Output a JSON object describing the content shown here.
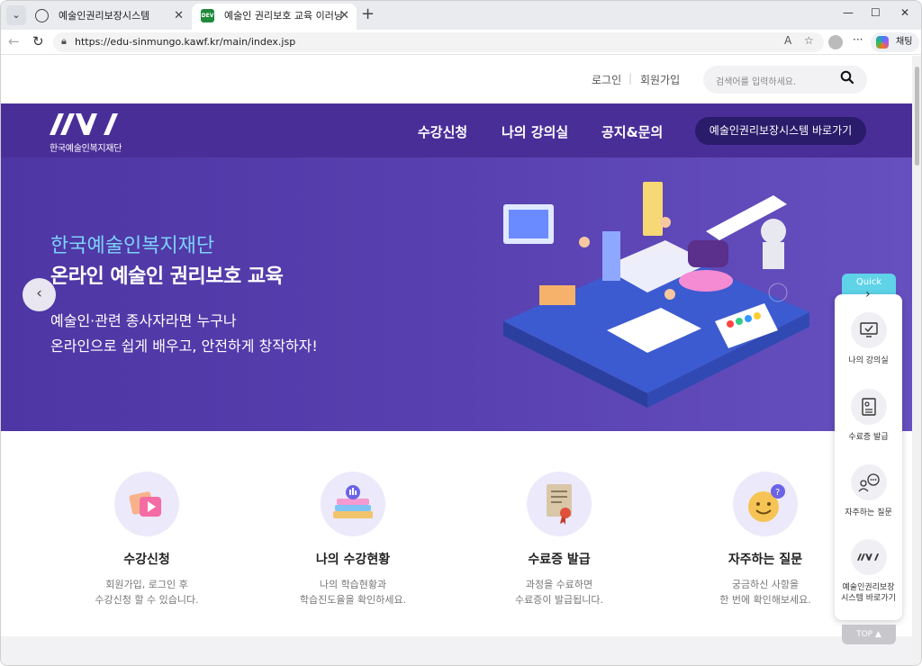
{
  "browser": {
    "tabs": [
      {
        "title": "예술인권리보장시스템"
      },
      {
        "title": "예술인 권리보호 교육 이러닝"
      }
    ],
    "address": "https://edu-sinmungo.kawf.kr/main/index.jsp",
    "copilot_label": "채팅",
    "dev_badge": "DEV"
  },
  "util": {
    "login": "로그인",
    "join": "회원가입",
    "search_placeholder": "검색어를 입력하세요."
  },
  "header": {
    "logo_mark": "KAWF",
    "logo_text": "한국예술인복지재단",
    "menu": [
      {
        "label": "수강신청"
      },
      {
        "label": "나의 강의실"
      },
      {
        "label": "공지&문의"
      }
    ],
    "go_button": "예술인권리보장시스템 바로가기"
  },
  "hero": {
    "subtitle": "한국예술인복지재단",
    "title": "온라인 예술인 권리보호 교육",
    "desc1": "예술인·관련 종사자라면 누구나",
    "desc2": "온라인으로 쉽게 배우고, 안전하게 창작하자!"
  },
  "services": [
    {
      "name": "수강신청",
      "desc1": "회원가입, 로그인 후",
      "desc2": "수강신청 할 수 있습니다."
    },
    {
      "name": "나의 수강현황",
      "desc1": "나의 학습현황과",
      "desc2": "학습진도율을 확인하세요."
    },
    {
      "name": "수료증 발급",
      "desc1": "과정을 수료하면",
      "desc2": "수료증이 발급됩니다."
    },
    {
      "name": "자주하는 질문",
      "desc1": "궁금하신 사항을",
      "desc2": "한 번에 확인해보세요."
    }
  ],
  "quick": {
    "tab": "Quick",
    "items": [
      {
        "label1": "나의 강의실",
        "label2": ""
      },
      {
        "label1": "수료증 발급",
        "label2": ""
      },
      {
        "label1": "자주하는 질문",
        "label2": ""
      },
      {
        "label1": "예술인권리보장",
        "label2": "시스템 바로가기"
      }
    ],
    "top": "TOP ▲"
  },
  "colors": {
    "nav_bg": "#4a2e98",
    "hero_bg": "#5840b0",
    "accent_cyan": "#7dd3fc",
    "button_dark": "#2a1b6b"
  }
}
